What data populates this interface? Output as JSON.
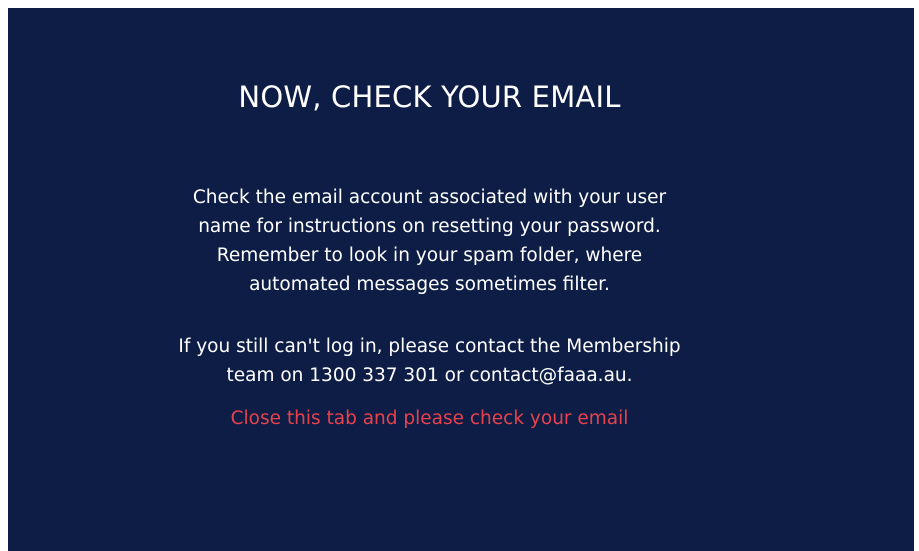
{
  "heading": "NOW, CHECK YOUR EMAIL",
  "instructions": {
    "lines": [
      "Check the email account associated with your user",
      "name for instructions on resetting your password.",
      "Remember to look in your spam folder, where",
      "automated messages sometimes filter."
    ]
  },
  "contact": {
    "lines": [
      "If you still can't log in, please contact the Membership",
      "team on 1300 337 301 or contact@faaa.au."
    ]
  },
  "close_link": "Close this tab and please check your email",
  "colors": {
    "background": "#0d1d45",
    "text": "#ffffff",
    "link": "#e8424c"
  }
}
